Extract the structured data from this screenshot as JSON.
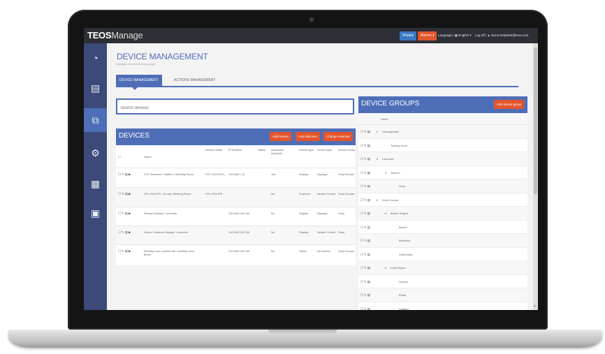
{
  "app": {
    "brand_bold": "TEOS",
    "brand_light": "Manage",
    "wizard_label": "Wizard",
    "alarms_label": "Alarms ▾",
    "language_label": "Language | ▦ English ▾",
    "user_label": "Log off | ▲ demo.helpdesk@teos.com"
  },
  "sidebar": {
    "items": [
      {
        "icon": "dashboard-icon",
        "glyph": "◔"
      },
      {
        "icon": "list-icon",
        "glyph": "▤"
      },
      {
        "icon": "devices-icon",
        "glyph": "⧉"
      },
      {
        "icon": "settings-icon",
        "glyph": "⚙"
      },
      {
        "icon": "report-icon",
        "glyph": "▦"
      },
      {
        "icon": "image-icon",
        "glyph": "▣"
      }
    ],
    "active_index": 2
  },
  "page": {
    "title": "DEVICE MANAGEMENT",
    "subtitle": "Manage all devices and groups",
    "tabs": [
      "DEVICE MANAGEMENT",
      "ACTIONS MANAGEMENT"
    ]
  },
  "search": {
    "placeholder": "Search devices",
    "value": ""
  },
  "devices": {
    "title": "DEVICES",
    "buttons": [
      "Add Device",
      "Auto discover",
      "Change selected"
    ],
    "columns": [
      "Name",
      "Device model",
      "IP Address",
      "Status",
      "Automatic schedule",
      "Device type",
      "Screen type",
      "Device Group"
    ],
    "rows": [
      {
        "name": "HTC-Sweden1 / Malmo / Meeting Room",
        "model": "HTC 16LD2021",
        "ip": "192.168.1.12",
        "status": "",
        "schedule": "Yes",
        "type": "Display",
        "screen": "Signage",
        "group": "Sony Europe"
      },
      {
        "name": "NTL-PHILIPS / Europe Meeting Room",
        "model": "NTL-PHILIPS",
        "ip": "",
        "status": "",
        "schedule": "No",
        "type": "Projector",
        "screen": "Simple Control",
        "group": "Sony Europe"
      },
      {
        "name": "Kilmarit Display / Lavender",
        "model": "",
        "ip": "192.168.100.130",
        "status": "",
        "schedule": "No",
        "type": "Display",
        "screen": "Signage",
        "group": "Sony"
      },
      {
        "name": "Yellow Cafeteria Display / Lavender",
        "model": "",
        "ip": "192.168.100.139",
        "status": "",
        "schedule": "No",
        "type": "Display",
        "screen": "Simple Control",
        "group": "Sony"
      },
      {
        "name": "Meeting room central hall / Meeting room Berlin",
        "model": "",
        "ip": "192.168.100.199",
        "status": "",
        "schedule": "No",
        "type": "Tablet",
        "screen": "No Screen",
        "group": "Sony Europe"
      }
    ]
  },
  "groups": {
    "title": "DEVICE GROUPS",
    "add_button": "Add device group",
    "column": "Name",
    "rows": [
      {
        "name": "Unassignable",
        "depth": 0,
        "toggle": "▾"
      },
      {
        "name": "Tesking room",
        "depth": 1,
        "toggle": ""
      },
      {
        "name": "Lavender",
        "depth": 0,
        "toggle": "▾"
      },
      {
        "name": "Ravcen",
        "depth": 1,
        "toggle": "▾"
      },
      {
        "name": "Sony",
        "depth": 2,
        "toggle": ""
      },
      {
        "name": "Sony Europe",
        "depth": 0,
        "toggle": "▾"
      },
      {
        "name": "Baden Region",
        "depth": 1,
        "toggle": "▾"
      },
      {
        "name": "Bedrid",
        "depth": 2,
        "toggle": ""
      },
      {
        "name": "Beeksley",
        "depth": 2,
        "toggle": ""
      },
      {
        "name": "Sutherland",
        "depth": 2,
        "toggle": ""
      },
      {
        "name": "East Region",
        "depth": 1,
        "toggle": "▾"
      },
      {
        "name": "Seveso",
        "depth": 2,
        "toggle": ""
      },
      {
        "name": "Etsall",
        "depth": 2,
        "toggle": ""
      },
      {
        "name": "Holland",
        "depth": 2,
        "toggle": ""
      }
    ]
  },
  "colors": {
    "accent": "#4f6eb8",
    "sidebar": "#3b4a78",
    "action": "#e4552d",
    "topbar": "#2c2f35"
  }
}
